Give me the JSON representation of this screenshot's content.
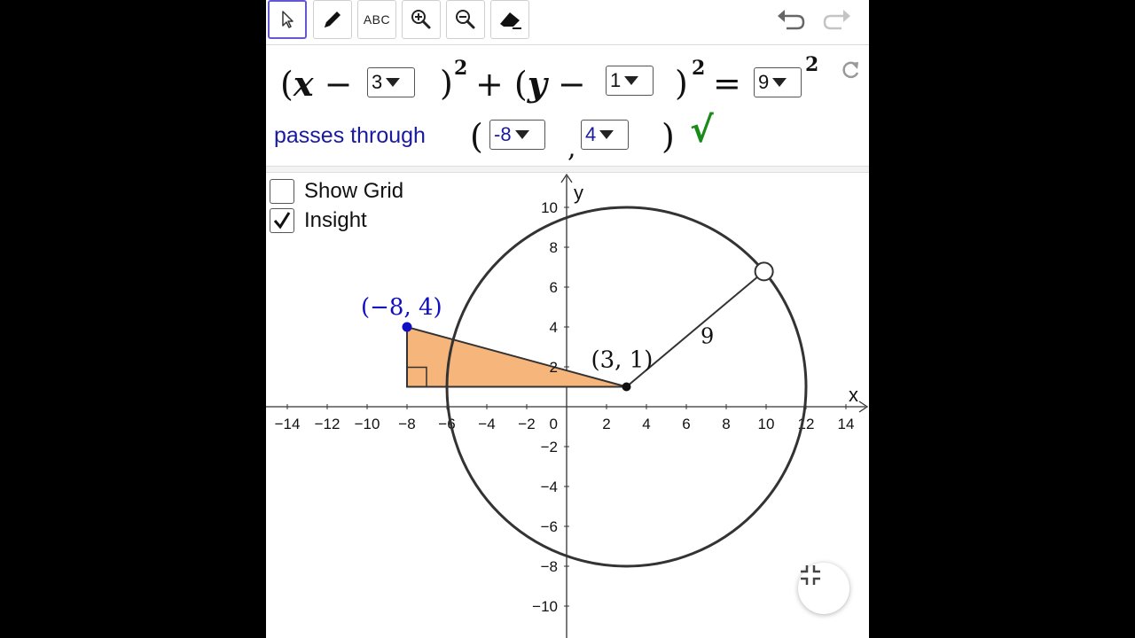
{
  "toolbar": {
    "tools": [
      {
        "name": "move",
        "icon": "cursor-arrow-icon",
        "active": true
      },
      {
        "name": "pen",
        "icon": "pencil-icon"
      },
      {
        "name": "text",
        "label": "ABC"
      },
      {
        "name": "zoom-in",
        "icon": "zoom-in-icon"
      },
      {
        "name": "zoom-out",
        "icon": "zoom-out-icon"
      },
      {
        "name": "delete",
        "icon": "eraser-icon"
      }
    ],
    "undo_icon": "undo-icon",
    "redo_icon": "redo-icon"
  },
  "equation": {
    "h_value": "3",
    "k_value": "1",
    "r_value": "9",
    "exponent": "2",
    "reset_icon": "refresh-icon"
  },
  "passes": {
    "label": "passes through",
    "x_value": "-8",
    "y_value": "4",
    "status_mark": "√",
    "status_color": "#1a8a1a"
  },
  "checkboxes": {
    "show_grid": {
      "label": "Show Grid",
      "checked": false
    },
    "insight": {
      "label": "Insight",
      "checked": true
    }
  },
  "graph": {
    "x_axis_label": "x",
    "y_axis_label": "y",
    "x_ticks": [
      -14,
      -12,
      -10,
      -8,
      -6,
      -4,
      -2,
      2,
      4,
      6,
      8,
      10,
      12,
      14
    ],
    "y_ticks": [
      -10,
      -8,
      -6,
      -4,
      -2,
      2,
      4,
      6,
      8,
      10
    ],
    "origin_label": "0",
    "center": {
      "x": 3,
      "y": 1,
      "label": "(3, 1)"
    },
    "radius": 9,
    "radius_label": "9",
    "point": {
      "x": -8,
      "y": 4,
      "label": "(−8, 4)",
      "color": "#1010c0"
    },
    "radius_end_angle_deg": 40,
    "triangle_fill": "#f6b57a",
    "circle_color": "#333333"
  },
  "fullscreen_icon": "collapse-fullscreen-icon"
}
